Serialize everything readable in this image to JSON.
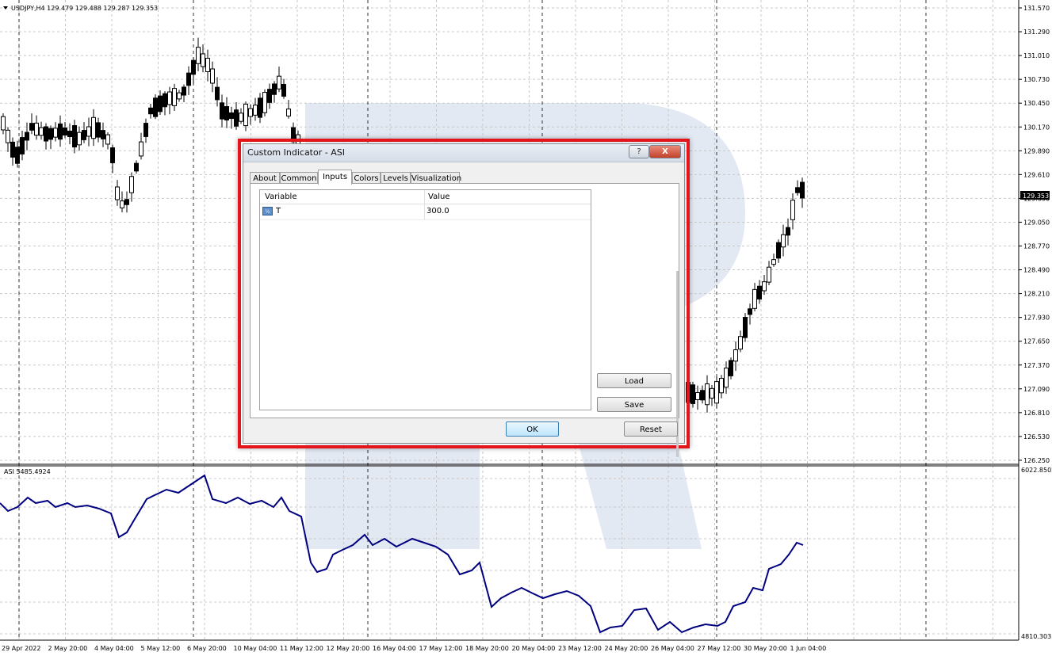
{
  "chart": {
    "symbol_header": "USDJPY,H4  129.479 129.488 129.287 129.353",
    "current_price": "129.353",
    "price_scale": [
      "131.570",
      "131.290",
      "131.010",
      "130.730",
      "130.450",
      "130.170",
      "129.890",
      "129.610",
      "129.330",
      "129.050",
      "128.770",
      "128.490",
      "128.210",
      "127.930",
      "127.650",
      "127.370",
      "127.090",
      "126.810",
      "126.530",
      "126.250"
    ],
    "indicator_header": "ASI 5485.4924",
    "indicator_scale": [
      "6022.8502",
      "4810.3031"
    ],
    "time_labels": [
      "29 Apr 2022",
      "2 May 20:00",
      "4 May 04:00",
      "5 May 12:00",
      "6 May 20:00",
      "10 May 04:00",
      "11 May 12:00",
      "12 May 20:00",
      "16 May 04:00",
      "17 May 12:00",
      "18 May 20:00",
      "20 May 04:00",
      "23 May 12:00",
      "24 May 20:00",
      "26 May 04:00",
      "27 May 12:00",
      "30 May 20:00",
      "1 Jun 04:00"
    ],
    "colors": {
      "bull": "#ffffff",
      "bear": "#000000",
      "asi_line": "#000080",
      "watermark": "#e3e9f3",
      "grid": "#c8c8c8"
    }
  },
  "dialog": {
    "title": "Custom Indicator - ASI",
    "help_label": "?",
    "close_label": "X",
    "tabs": [
      "About",
      "Common",
      "Inputs",
      "Colors",
      "Levels",
      "Visualization"
    ],
    "active_tab": "Inputs",
    "inputs_table": {
      "headers": [
        "Variable",
        "Value"
      ],
      "rows": [
        {
          "icon": "numeric-param-icon",
          "icon_text": "½",
          "variable": "T",
          "value": "300.0"
        }
      ]
    },
    "load_label": "Load",
    "save_label": "Save",
    "ok_label": "OK",
    "reset_label": "Reset"
  }
}
